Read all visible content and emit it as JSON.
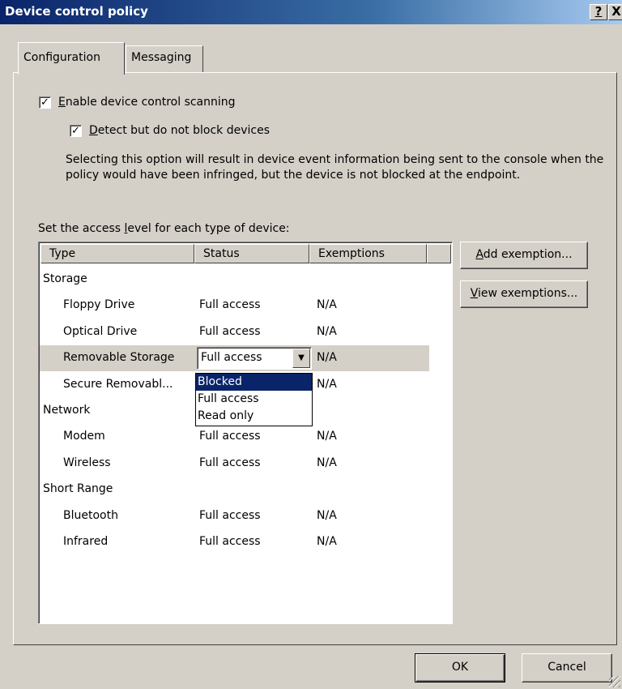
{
  "window": {
    "title": "Device control policy",
    "help_label": "?",
    "close_label": "X"
  },
  "tabs": [
    {
      "label": "Configuration",
      "active": true
    },
    {
      "label": "Messaging",
      "active": false
    }
  ],
  "options": {
    "enable_scanning": {
      "prefix": "E",
      "rest": "nable device control scanning",
      "checked": true
    },
    "detect_only": {
      "prefix": "D",
      "rest": "etect but do not block devices",
      "checked": true
    },
    "description": "Selecting this option will result in device event information being sent to the console when the policy would have been infringed, but the device is not blocked at the endpoint."
  },
  "access_label": {
    "before": "Set the access ",
    "key": "l",
    "after": "evel for each type of device:"
  },
  "list": {
    "columns": [
      "Type",
      "Status",
      "Exemptions"
    ],
    "rows": [
      {
        "type": "Storage",
        "status": "",
        "exemptions": "",
        "group": true
      },
      {
        "type": "Floppy Drive",
        "status": "Full access",
        "exemptions": "N/A"
      },
      {
        "type": "Optical Drive",
        "status": "Full access",
        "exemptions": "N/A"
      },
      {
        "type": "Removable Storage",
        "status": "Full access",
        "exemptions": "N/A",
        "selected": true
      },
      {
        "type": "Secure Removabl...",
        "status": "",
        "exemptions": "N/A"
      },
      {
        "type": "Network",
        "status": "",
        "exemptions": "",
        "group": true
      },
      {
        "type": "Modem",
        "status": "Full access",
        "exemptions": "N/A"
      },
      {
        "type": "Wireless",
        "status": "Full access",
        "exemptions": "N/A"
      },
      {
        "type": "Short Range",
        "status": "",
        "exemptions": "",
        "group": true
      },
      {
        "type": "Bluetooth",
        "status": "Full access",
        "exemptions": "N/A"
      },
      {
        "type": "Infrared",
        "status": "Full access",
        "exemptions": "N/A"
      }
    ]
  },
  "combo": {
    "value": "Full access",
    "options": [
      "Blocked",
      "Full access",
      "Read only"
    ],
    "highlighted": "Blocked"
  },
  "buttons": {
    "add_exemption": {
      "key": "A",
      "rest": "dd exemption..."
    },
    "view_exemptions": {
      "key": "V",
      "rest": "iew exemptions..."
    },
    "ok": "OK",
    "cancel": "Cancel"
  },
  "colors": {
    "dialog_bg": "#d4d0c8",
    "title_start": "#0a246a",
    "title_end": "#a6caf0",
    "selection": "#0a246a"
  }
}
